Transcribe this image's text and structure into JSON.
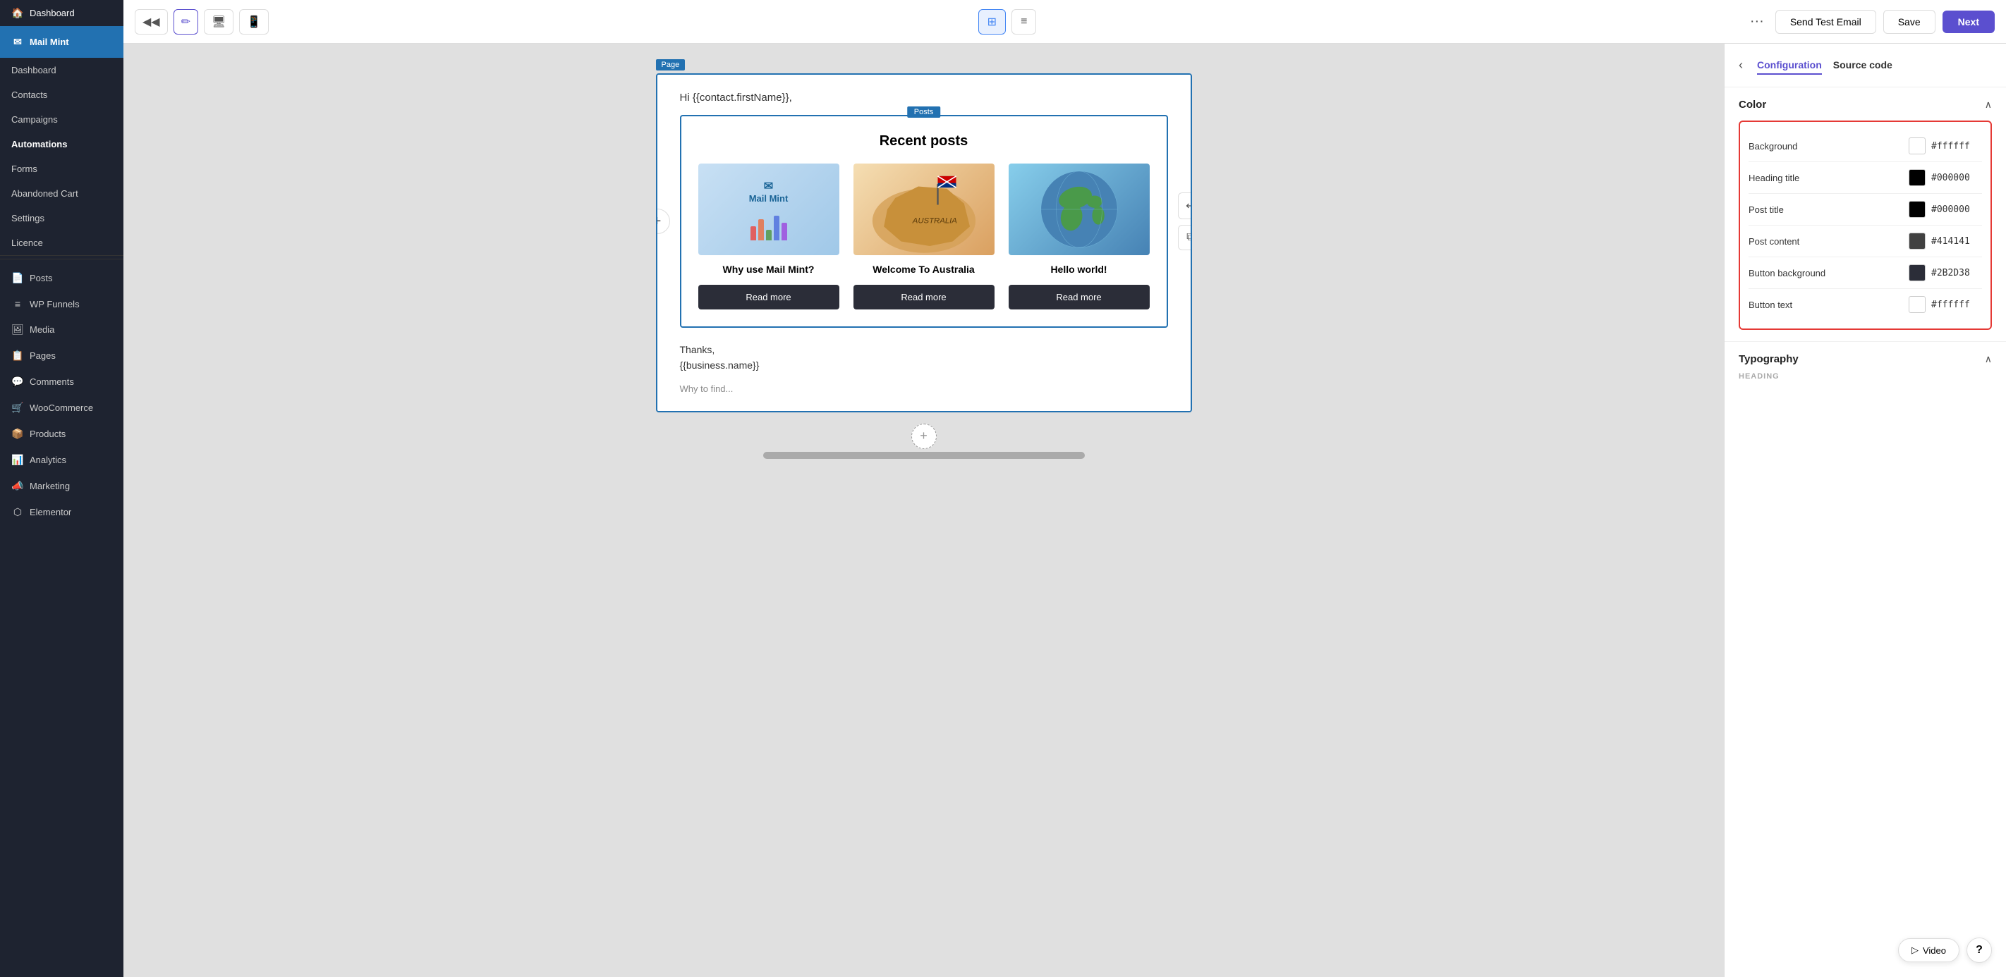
{
  "sidebar": {
    "wp_logo": "🏠",
    "dashboard_label": "Dashboard",
    "mail_mint_label": "Mail Mint",
    "mail_mint_icon": "✉",
    "items": [
      {
        "id": "dashboard",
        "label": "Dashboard",
        "icon": ""
      },
      {
        "id": "contacts",
        "label": "Contacts",
        "icon": ""
      },
      {
        "id": "campaigns",
        "label": "Campaigns",
        "icon": ""
      },
      {
        "id": "automations",
        "label": "Automations",
        "icon": ""
      },
      {
        "id": "forms",
        "label": "Forms",
        "icon": ""
      },
      {
        "id": "abandoned-cart",
        "label": "Abandoned Cart",
        "icon": ""
      },
      {
        "id": "settings",
        "label": "Settings",
        "icon": ""
      },
      {
        "id": "licence",
        "label": "Licence",
        "icon": ""
      }
    ],
    "plugin_items": [
      {
        "id": "posts",
        "label": "Posts",
        "icon": "📄"
      },
      {
        "id": "wp-funnels",
        "label": "WP Funnels",
        "icon": "≡"
      },
      {
        "id": "media",
        "label": "Media",
        "icon": "🖼"
      },
      {
        "id": "pages",
        "label": "Pages",
        "icon": "📋"
      },
      {
        "id": "comments",
        "label": "Comments",
        "icon": "💬"
      },
      {
        "id": "woocommerce",
        "label": "WooCommerce",
        "icon": "🛒"
      },
      {
        "id": "products",
        "label": "Products",
        "icon": "📦"
      },
      {
        "id": "analytics",
        "label": "Analytics",
        "icon": "📊"
      },
      {
        "id": "marketing",
        "label": "Marketing",
        "icon": "📣"
      },
      {
        "id": "elementor",
        "label": "Elementor",
        "icon": "⬡"
      }
    ]
  },
  "topbar": {
    "back_icon": "◀◀",
    "edit_icon": "✏",
    "desktop_icon": "🖥",
    "mobile_icon": "📱",
    "grid_icon": "⊞",
    "list_icon": "≡",
    "more_icon": "···",
    "send_test_email_label": "Send Test Email",
    "save_label": "Save",
    "next_label": "Next"
  },
  "canvas": {
    "page_label": "Page",
    "posts_label": "Posts",
    "greeting": "Hi {{contact.firstName}},",
    "posts_heading": "Recent posts",
    "posts": [
      {
        "id": "post-1",
        "title": "Why use Mail Mint?",
        "read_more_label": "Read more",
        "image_type": "mailmint"
      },
      {
        "id": "post-2",
        "title": "Welcome To Australia",
        "read_more_label": "Read more",
        "image_type": "australia"
      },
      {
        "id": "post-3",
        "title": "Hello world!",
        "read_more_label": "Read more",
        "image_type": "world"
      }
    ],
    "thanks_line1": "Thanks,",
    "thanks_line2": "{{business.name}}",
    "bottom_placeholder": "Why to find..."
  },
  "right_panel": {
    "back_icon": "‹",
    "tab_configuration": "Configuration",
    "tab_source_code": "Source code",
    "color_section_title": "Color",
    "collapse_icon": "∧",
    "colors": [
      {
        "id": "background",
        "label": "Background",
        "value": "#ffffff",
        "swatch": "#ffffff"
      },
      {
        "id": "heading-title",
        "label": "Heading title",
        "value": "#000000",
        "swatch": "#000000"
      },
      {
        "id": "post-title",
        "label": "Post title",
        "value": "#000000",
        "swatch": "#000000"
      },
      {
        "id": "post-content",
        "label": "Post content",
        "value": "#414141",
        "swatch": "#414141"
      },
      {
        "id": "button-background",
        "label": "Button background",
        "value": "#2B2D38",
        "swatch": "#2B2D38"
      },
      {
        "id": "button-text",
        "label": "Button text",
        "value": "#ffffff",
        "swatch": "#ffffff"
      }
    ],
    "typography_section_title": "Typography",
    "typography_collapse_icon": "∧",
    "heading_label": "HEADING"
  },
  "floating": {
    "video_icon": "▷",
    "video_label": "Video",
    "help_label": "?"
  }
}
